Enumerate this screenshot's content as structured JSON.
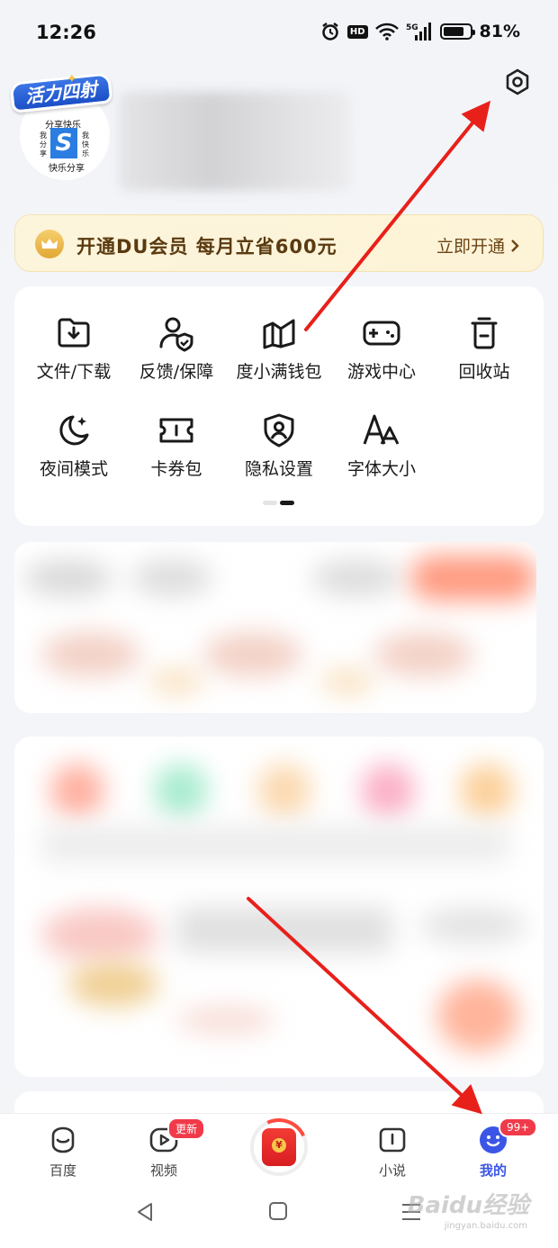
{
  "status_bar": {
    "time": "12:26",
    "hd": "HD",
    "network": "5G",
    "battery": "81%",
    "battery_level": 0.81
  },
  "profile": {
    "avatar_banner": "活力四射",
    "avatar_line1": "分享快乐",
    "avatar_left": "我分享",
    "avatar_right": "我快乐",
    "avatar_logo": "S",
    "avatar_line2": "快乐分享"
  },
  "vip": {
    "text": "开通DU会员 每月立省600元",
    "action": "立即开通"
  },
  "tools": [
    {
      "label": "文件/下载",
      "icon": "download-folder-icon"
    },
    {
      "label": "反馈/保障",
      "icon": "user-shield-icon"
    },
    {
      "label": "度小满钱包",
      "icon": "wallet-icon"
    },
    {
      "label": "游戏中心",
      "icon": "gamepad-icon"
    },
    {
      "label": "回收站",
      "icon": "trash-icon"
    },
    {
      "label": "夜间模式",
      "icon": "moon-icon"
    },
    {
      "label": "卡券包",
      "icon": "ticket-icon"
    },
    {
      "label": "隐私设置",
      "icon": "privacy-icon"
    },
    {
      "label": "字体大小",
      "icon": "font-size-icon"
    }
  ],
  "tabbar": {
    "tabs": [
      {
        "label": "百度",
        "icon": "baidu-face-icon"
      },
      {
        "label": "视频",
        "icon": "video-icon",
        "badge": "更新"
      },
      {
        "label": "",
        "icon": "red-packet-icon"
      },
      {
        "label": "小说",
        "icon": "book-icon"
      },
      {
        "label": "我的",
        "icon": "profile-face-icon",
        "badge": "99+"
      }
    ],
    "active": "我的"
  },
  "watermark": {
    "text": "Baidu经验",
    "sub": "jingyan.baidu.com"
  },
  "colors": {
    "accent": "#3b55e6",
    "badge": "#f03a4a",
    "vip_text": "#5a3a10",
    "arrow": "#e8201a"
  }
}
